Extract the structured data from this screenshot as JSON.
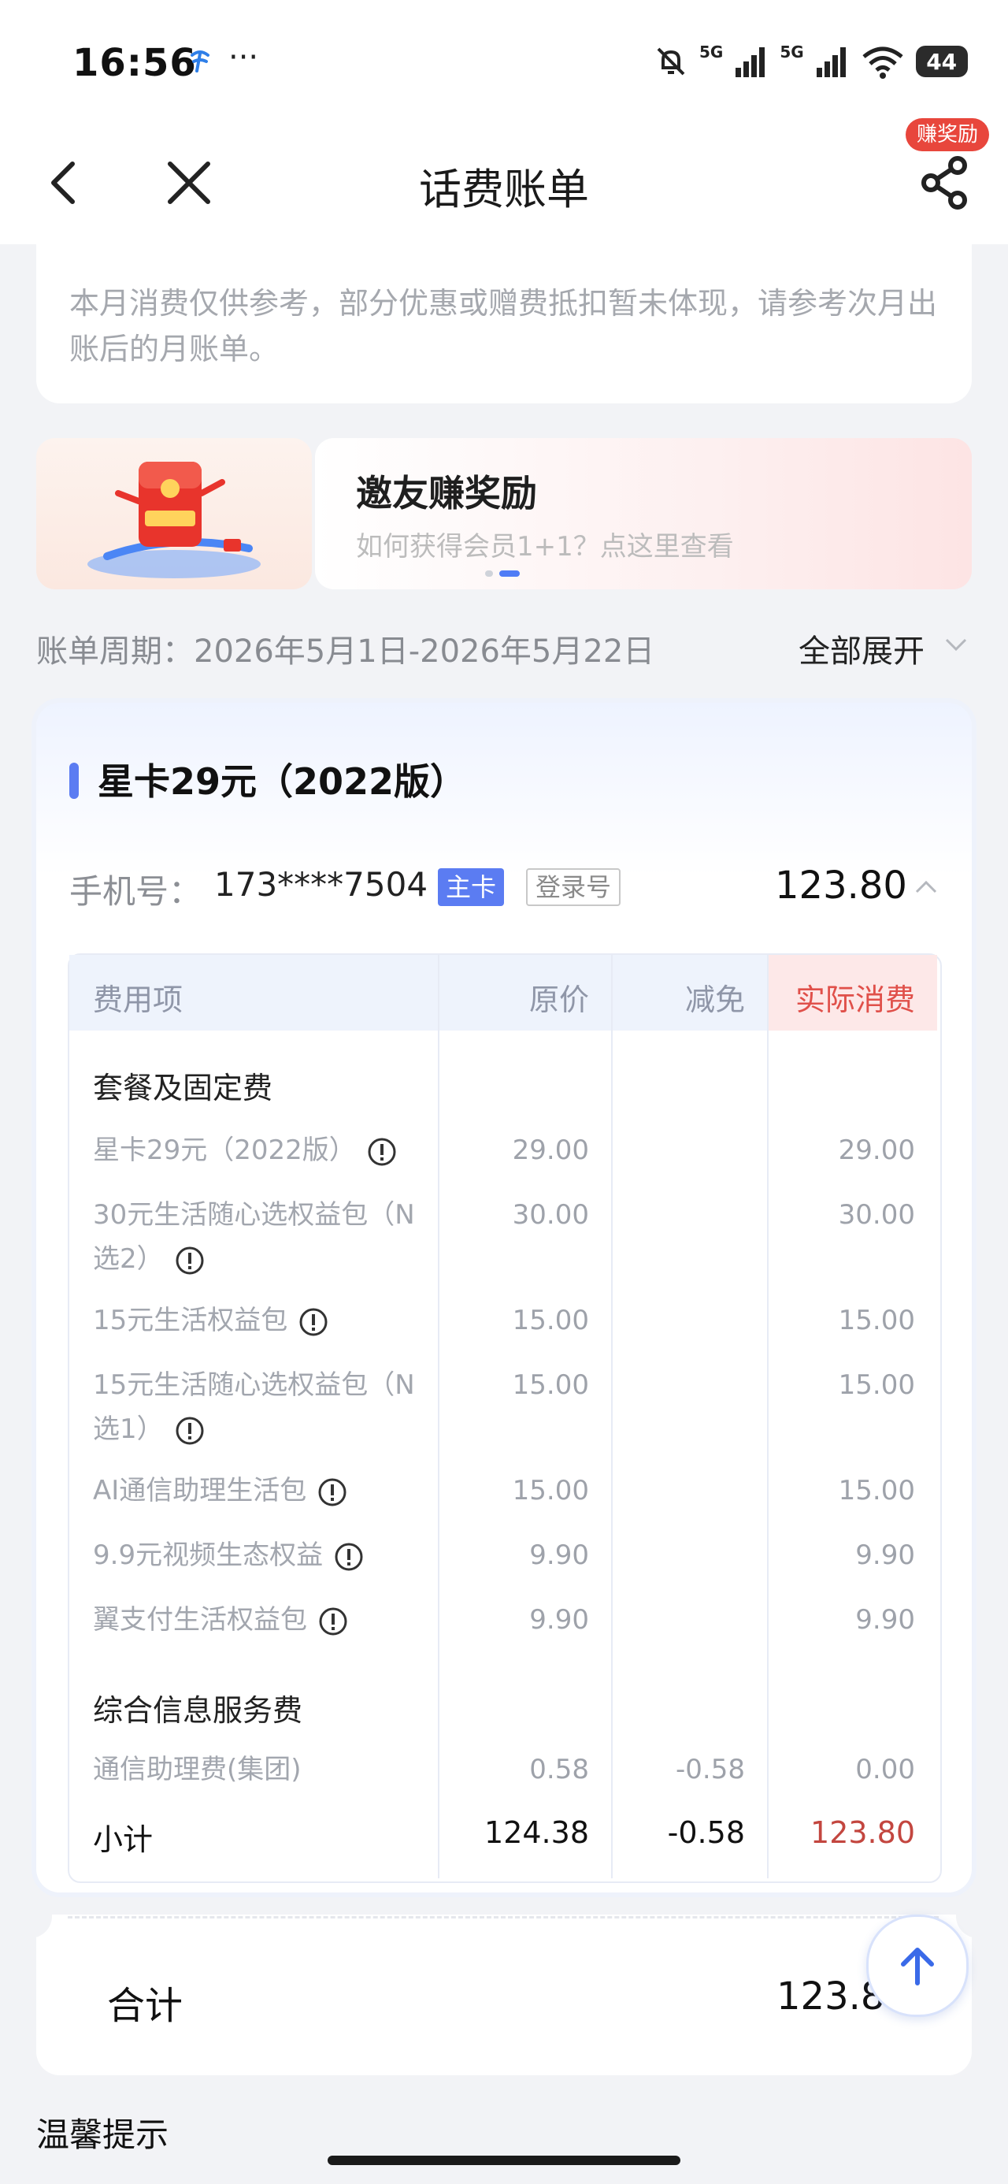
{
  "status_bar": {
    "time": "16:56",
    "more": "···",
    "signal1_label": "5G",
    "signal2_label": "5G",
    "battery": "44",
    "icons": [
      "carrier-icon",
      "mute-icon",
      "signal-icon",
      "wifi-icon",
      "battery-icon"
    ]
  },
  "nav": {
    "title": "话费账单",
    "reward_badge": "赚奖励",
    "icons": [
      "back-icon",
      "close-icon",
      "share-icon"
    ]
  },
  "notice": {
    "text": "本月消费仅供参考，部分优惠或赠费抵扣暂未体现，请参考次月出账后的月账单。"
  },
  "banner": {
    "title": "邀友赚奖励",
    "subtitle": "如何获得会员1+1？点这里查看",
    "total_slides": 2,
    "active_slide": 2
  },
  "period": {
    "label": "账单周期：2026年5月1日-2026年5月22日",
    "expand_all": "全部展开"
  },
  "plan": {
    "title": "星卡29元（2022版）",
    "phone_label": "手机号：",
    "phone_number": "173****7504",
    "tag_main": "主卡",
    "tag_login": "登录号",
    "phone_total": "123.80"
  },
  "table": {
    "headers": {
      "item": "费用项",
      "original": "原价",
      "discount": "减免",
      "actual": "实际消费"
    },
    "sections": [
      {
        "title": "套餐及固定费",
        "rows": [
          {
            "name": "星卡29元（2022版）",
            "original": "29.00",
            "discount": "",
            "actual": "29.00"
          },
          {
            "name": "30元生活随心选权益包（N选2）",
            "original": "30.00",
            "discount": "",
            "actual": "30.00"
          },
          {
            "name": "15元生活权益包",
            "original": "15.00",
            "discount": "",
            "actual": "15.00"
          },
          {
            "name": "15元生活随心选权益包（N选1）",
            "original": "15.00",
            "discount": "",
            "actual": "15.00"
          },
          {
            "name": "AI通信助理生活包",
            "original": "15.00",
            "discount": "",
            "actual": "15.00"
          },
          {
            "name": "9.9元视频生态权益",
            "original": "9.90",
            "discount": "",
            "actual": "9.90"
          },
          {
            "name": "翼支付生活权益包",
            "original": "9.90",
            "discount": "",
            "actual": "9.90"
          }
        ]
      },
      {
        "title": "综合信息服务费",
        "rows": [
          {
            "name": "通信助理费(集团)",
            "original": "0.58",
            "discount": "-0.58",
            "actual": "0.00"
          }
        ]
      }
    ],
    "subtotal": {
      "label": "小计",
      "original": "124.38",
      "discount": "-0.58",
      "actual": "123.80"
    }
  },
  "total": {
    "label": "合计",
    "value": "123.80"
  },
  "tips": {
    "title": "温馨提示"
  },
  "colors": {
    "accent_blue": "#5b7cf2",
    "actual_red": "#c3463f",
    "badge_red": "#e8463c"
  }
}
